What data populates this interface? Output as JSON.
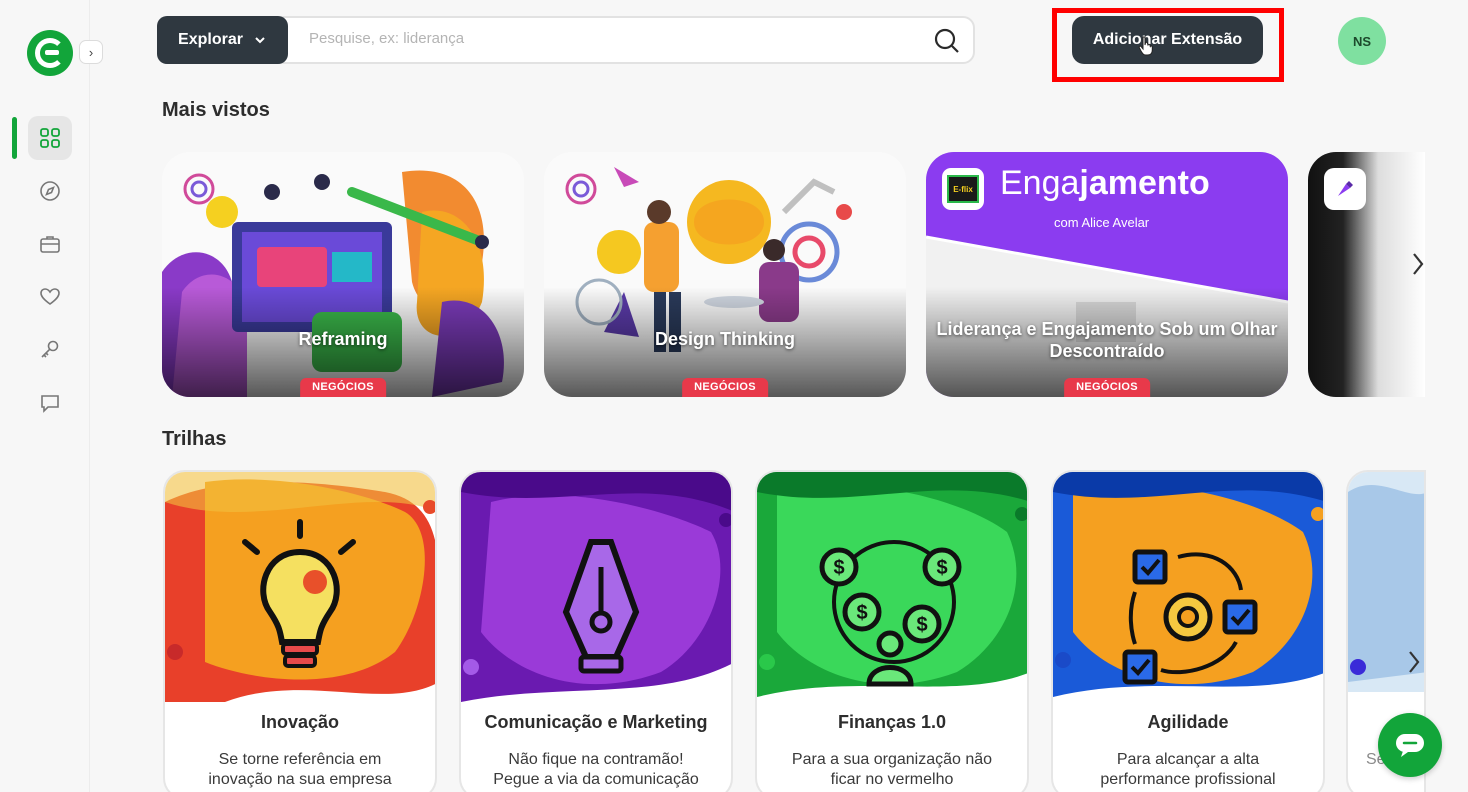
{
  "sidebar": {
    "expand_icon": "chevron-right-icon",
    "items": [
      {
        "name": "grid",
        "icon": "grid-icon",
        "active": true
      },
      {
        "name": "explore",
        "icon": "compass-icon",
        "active": false
      },
      {
        "name": "briefcase",
        "icon": "briefcase-icon",
        "active": false
      },
      {
        "name": "favorites",
        "icon": "heart-icon",
        "active": false
      },
      {
        "name": "key",
        "icon": "key-icon",
        "active": false
      },
      {
        "name": "messages",
        "icon": "chat-icon",
        "active": false
      }
    ]
  },
  "header": {
    "explore_label": "Explorar",
    "search_placeholder": "Pesquise, ex: liderança",
    "search_value": "",
    "add_extension_label": "Adicionar Extensão",
    "avatar_initials": "NS"
  },
  "sections": {
    "most_viewed_title": "Mais vistos",
    "trails_title": "Trilhas"
  },
  "courses": [
    {
      "title": "Reframing",
      "tag": "NEGÓCIOS"
    },
    {
      "title": "Design Thinking",
      "tag": "NEGÓCIOS"
    },
    {
      "title": "Liderança e Engajamento Sob um Olhar Descontraído",
      "tag": "NEGÓCIOS",
      "banner_title_prefix": "Enga",
      "banner_title_accent": "ja",
      "banner_title_suffix": "mento",
      "banner_subtitle": "com Alice Avelar",
      "badge_text": "E-flix"
    }
  ],
  "trails": [
    {
      "title": "Inovação",
      "desc_line1": "Se torne referência em",
      "desc_line2": "inovação na sua empresa"
    },
    {
      "title": "Comunicação e Marketing",
      "desc_line1": "Não fique na contramão!",
      "desc_line2": "Pegue a via da comunicação"
    },
    {
      "title": "Finanças 1.0",
      "desc_line1": "Para a sua organização não",
      "desc_line2": "ficar no vermelho"
    },
    {
      "title": "Agilidade",
      "desc_line1": "Para alcançar a alta",
      "desc_line2": "performance profissional"
    },
    {
      "title": "",
      "desc_line1": "Se",
      "desc_line2": ""
    }
  ],
  "colors": {
    "brand_green": "#12a53a",
    "dark_button": "#2f3840",
    "tag_red": "#e8394a",
    "highlight_red": "#ff0000",
    "engajamento_purple": "#8b3cf0"
  }
}
